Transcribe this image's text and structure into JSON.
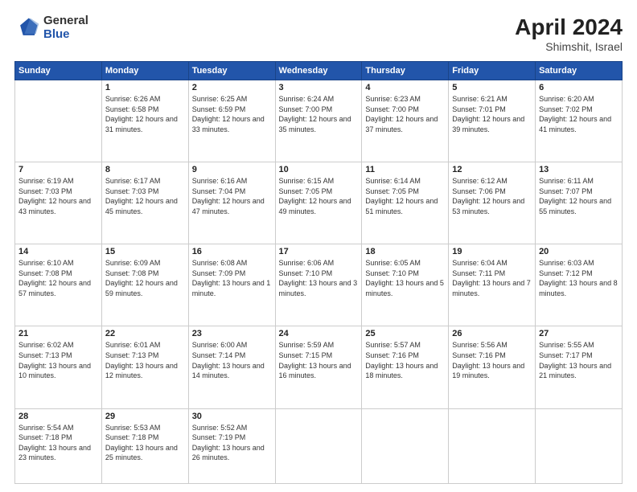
{
  "header": {
    "logo_general": "General",
    "logo_blue": "Blue",
    "title": "April 2024",
    "location": "Shimshit, Israel"
  },
  "days_of_week": [
    "Sunday",
    "Monday",
    "Tuesday",
    "Wednesday",
    "Thursday",
    "Friday",
    "Saturday"
  ],
  "weeks": [
    [
      {
        "num": "",
        "sunrise": "",
        "sunset": "",
        "daylight": ""
      },
      {
        "num": "1",
        "sunrise": "Sunrise: 6:26 AM",
        "sunset": "Sunset: 6:58 PM",
        "daylight": "Daylight: 12 hours and 31 minutes."
      },
      {
        "num": "2",
        "sunrise": "Sunrise: 6:25 AM",
        "sunset": "Sunset: 6:59 PM",
        "daylight": "Daylight: 12 hours and 33 minutes."
      },
      {
        "num": "3",
        "sunrise": "Sunrise: 6:24 AM",
        "sunset": "Sunset: 7:00 PM",
        "daylight": "Daylight: 12 hours and 35 minutes."
      },
      {
        "num": "4",
        "sunrise": "Sunrise: 6:23 AM",
        "sunset": "Sunset: 7:00 PM",
        "daylight": "Daylight: 12 hours and 37 minutes."
      },
      {
        "num": "5",
        "sunrise": "Sunrise: 6:21 AM",
        "sunset": "Sunset: 7:01 PM",
        "daylight": "Daylight: 12 hours and 39 minutes."
      },
      {
        "num": "6",
        "sunrise": "Sunrise: 6:20 AM",
        "sunset": "Sunset: 7:02 PM",
        "daylight": "Daylight: 12 hours and 41 minutes."
      }
    ],
    [
      {
        "num": "7",
        "sunrise": "Sunrise: 6:19 AM",
        "sunset": "Sunset: 7:03 PM",
        "daylight": "Daylight: 12 hours and 43 minutes."
      },
      {
        "num": "8",
        "sunrise": "Sunrise: 6:17 AM",
        "sunset": "Sunset: 7:03 PM",
        "daylight": "Daylight: 12 hours and 45 minutes."
      },
      {
        "num": "9",
        "sunrise": "Sunrise: 6:16 AM",
        "sunset": "Sunset: 7:04 PM",
        "daylight": "Daylight: 12 hours and 47 minutes."
      },
      {
        "num": "10",
        "sunrise": "Sunrise: 6:15 AM",
        "sunset": "Sunset: 7:05 PM",
        "daylight": "Daylight: 12 hours and 49 minutes."
      },
      {
        "num": "11",
        "sunrise": "Sunrise: 6:14 AM",
        "sunset": "Sunset: 7:05 PM",
        "daylight": "Daylight: 12 hours and 51 minutes."
      },
      {
        "num": "12",
        "sunrise": "Sunrise: 6:12 AM",
        "sunset": "Sunset: 7:06 PM",
        "daylight": "Daylight: 12 hours and 53 minutes."
      },
      {
        "num": "13",
        "sunrise": "Sunrise: 6:11 AM",
        "sunset": "Sunset: 7:07 PM",
        "daylight": "Daylight: 12 hours and 55 minutes."
      }
    ],
    [
      {
        "num": "14",
        "sunrise": "Sunrise: 6:10 AM",
        "sunset": "Sunset: 7:08 PM",
        "daylight": "Daylight: 12 hours and 57 minutes."
      },
      {
        "num": "15",
        "sunrise": "Sunrise: 6:09 AM",
        "sunset": "Sunset: 7:08 PM",
        "daylight": "Daylight: 12 hours and 59 minutes."
      },
      {
        "num": "16",
        "sunrise": "Sunrise: 6:08 AM",
        "sunset": "Sunset: 7:09 PM",
        "daylight": "Daylight: 13 hours and 1 minute."
      },
      {
        "num": "17",
        "sunrise": "Sunrise: 6:06 AM",
        "sunset": "Sunset: 7:10 PM",
        "daylight": "Daylight: 13 hours and 3 minutes."
      },
      {
        "num": "18",
        "sunrise": "Sunrise: 6:05 AM",
        "sunset": "Sunset: 7:10 PM",
        "daylight": "Daylight: 13 hours and 5 minutes."
      },
      {
        "num": "19",
        "sunrise": "Sunrise: 6:04 AM",
        "sunset": "Sunset: 7:11 PM",
        "daylight": "Daylight: 13 hours and 7 minutes."
      },
      {
        "num": "20",
        "sunrise": "Sunrise: 6:03 AM",
        "sunset": "Sunset: 7:12 PM",
        "daylight": "Daylight: 13 hours and 8 minutes."
      }
    ],
    [
      {
        "num": "21",
        "sunrise": "Sunrise: 6:02 AM",
        "sunset": "Sunset: 7:13 PM",
        "daylight": "Daylight: 13 hours and 10 minutes."
      },
      {
        "num": "22",
        "sunrise": "Sunrise: 6:01 AM",
        "sunset": "Sunset: 7:13 PM",
        "daylight": "Daylight: 13 hours and 12 minutes."
      },
      {
        "num": "23",
        "sunrise": "Sunrise: 6:00 AM",
        "sunset": "Sunset: 7:14 PM",
        "daylight": "Daylight: 13 hours and 14 minutes."
      },
      {
        "num": "24",
        "sunrise": "Sunrise: 5:59 AM",
        "sunset": "Sunset: 7:15 PM",
        "daylight": "Daylight: 13 hours and 16 minutes."
      },
      {
        "num": "25",
        "sunrise": "Sunrise: 5:57 AM",
        "sunset": "Sunset: 7:16 PM",
        "daylight": "Daylight: 13 hours and 18 minutes."
      },
      {
        "num": "26",
        "sunrise": "Sunrise: 5:56 AM",
        "sunset": "Sunset: 7:16 PM",
        "daylight": "Daylight: 13 hours and 19 minutes."
      },
      {
        "num": "27",
        "sunrise": "Sunrise: 5:55 AM",
        "sunset": "Sunset: 7:17 PM",
        "daylight": "Daylight: 13 hours and 21 minutes."
      }
    ],
    [
      {
        "num": "28",
        "sunrise": "Sunrise: 5:54 AM",
        "sunset": "Sunset: 7:18 PM",
        "daylight": "Daylight: 13 hours and 23 minutes."
      },
      {
        "num": "29",
        "sunrise": "Sunrise: 5:53 AM",
        "sunset": "Sunset: 7:18 PM",
        "daylight": "Daylight: 13 hours and 25 minutes."
      },
      {
        "num": "30",
        "sunrise": "Sunrise: 5:52 AM",
        "sunset": "Sunset: 7:19 PM",
        "daylight": "Daylight: 13 hours and 26 minutes."
      },
      {
        "num": "",
        "sunrise": "",
        "sunset": "",
        "daylight": ""
      },
      {
        "num": "",
        "sunrise": "",
        "sunset": "",
        "daylight": ""
      },
      {
        "num": "",
        "sunrise": "",
        "sunset": "",
        "daylight": ""
      },
      {
        "num": "",
        "sunrise": "",
        "sunset": "",
        "daylight": ""
      }
    ]
  ]
}
